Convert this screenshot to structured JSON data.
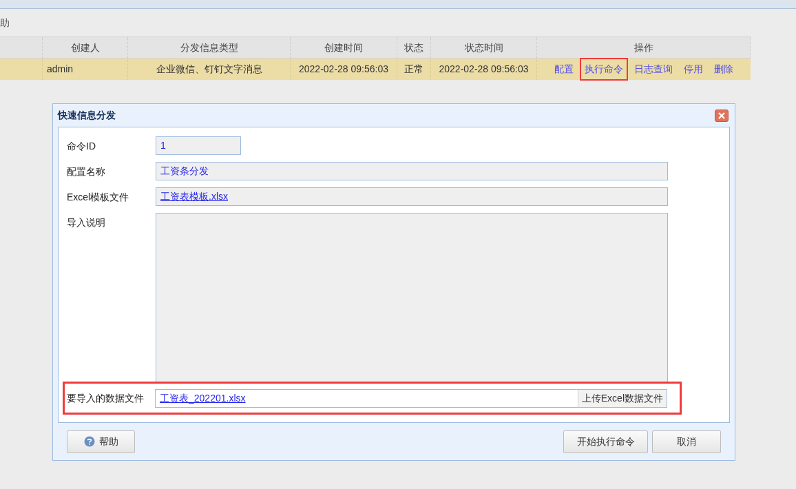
{
  "toolbar": {
    "partial_text": "助"
  },
  "table": {
    "columns": [
      "",
      "创建人",
      "分发信息类型",
      "创建时间",
      "状态",
      "状态时间",
      "操作"
    ],
    "rows": [
      {
        "selected": true,
        "cells": [
          "",
          "admin",
          "企业微信、钉钉文字消息",
          "2022-02-28 09:56:03",
          "正常",
          "2022-02-28 09:56:03"
        ],
        "actions": [
          {
            "label": "配置",
            "highlighted": false
          },
          {
            "label": "执行命令",
            "highlighted": true
          },
          {
            "label": "日志查询",
            "highlighted": false
          },
          {
            "label": "停用",
            "highlighted": false
          },
          {
            "label": "删除",
            "highlighted": false
          }
        ]
      }
    ]
  },
  "dialog": {
    "title": "快速信息分发",
    "fields": [
      {
        "kind": "short",
        "label": "命令ID",
        "value": "1"
      },
      {
        "kind": "text",
        "label": "配置名称",
        "value": "工资条分发"
      },
      {
        "kind": "link",
        "label": "Excel模板文件",
        "value": "工资表模板.xlsx"
      },
      {
        "kind": "area",
        "label": "导入说明"
      }
    ],
    "upload": {
      "label": "要导入的数据文件",
      "value": "工资表_202201.xlsx",
      "button": "上传Excel数据文件",
      "highlighted": true
    },
    "buttons": [
      {
        "kind": "help",
        "label": "帮助"
      },
      {
        "kind": "primary",
        "label": "开始执行命令"
      },
      {
        "kind": "cancel",
        "label": "取消"
      }
    ]
  }
}
